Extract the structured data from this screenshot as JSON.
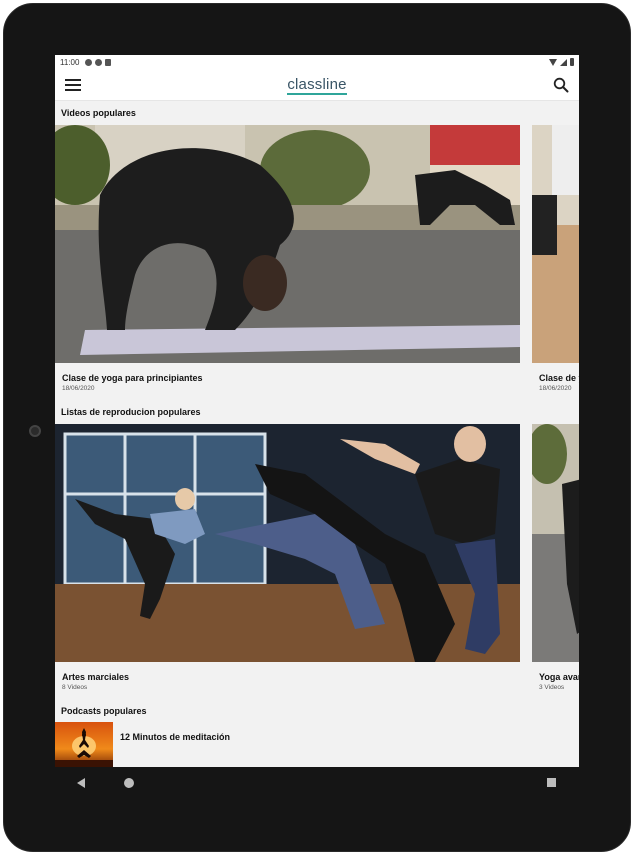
{
  "status_bar": {
    "time": "11:00"
  },
  "app_bar": {
    "logo": "classline",
    "menu_icon": "menu-icon",
    "search_icon": "search-icon"
  },
  "sections": {
    "popular_videos": {
      "title": "Videos populares",
      "items": [
        {
          "title": "Clase de yoga para principiantes",
          "date": "18/06/2020"
        },
        {
          "title": "Clase de y",
          "date": "18/06/2020"
        }
      ]
    },
    "popular_playlists": {
      "title": "Listas de reproducion populares",
      "items": [
        {
          "title": "Artes marciales",
          "count": "8 Videos"
        },
        {
          "title": "Yoga avar",
          "count": "3 Videos"
        }
      ]
    },
    "popular_podcasts": {
      "title": "Podcasts populares",
      "items": [
        {
          "title": "12 Minutos de meditación"
        }
      ]
    }
  },
  "nav_bar": {
    "back_icon": "back-icon",
    "home_icon": "home-icon",
    "recents_icon": "recents-icon"
  },
  "colors": {
    "accent": "#2fa59a",
    "logo": "#3a5566",
    "background": "#f2f2f2"
  }
}
